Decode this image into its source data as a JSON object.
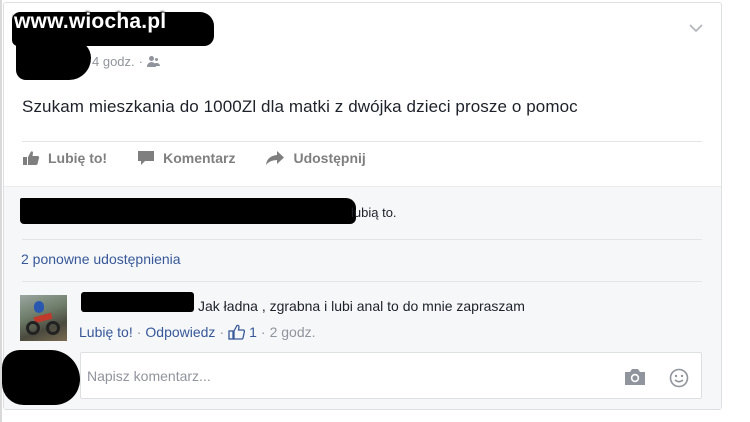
{
  "watermark": "www.wiocha.pl",
  "post": {
    "time": "4 godz.",
    "dot": "·",
    "audience_icon": "friends-icon",
    "menu_icon": "chevron-down-icon",
    "text": "Szukam mieszkania do 1000Zl dla matki z dwójka dzieci prosze o pomoc"
  },
  "actions": {
    "like": "Lubię to!",
    "comment": "Komentarz",
    "share": "Udostępnij"
  },
  "feedback": {
    "likes_suffix": "lubią to.",
    "shares": "2 ponowne udostępnienia"
  },
  "comment": {
    "text": "Jak ładna , zgrabna i lubi anal to do mnie zapraszam",
    "like": "Lubię to!",
    "reply": "Odpowiedz",
    "dot": "·",
    "like_count": "1",
    "time": "2 godz."
  },
  "composer": {
    "placeholder": "Napisz komentarz...",
    "camera_icon": "camera-icon",
    "emoji_icon": "smiley-icon"
  },
  "colors": {
    "link": "#365899",
    "muted": "#90949c",
    "action": "#7f7f7f",
    "text": "#1d2129"
  }
}
